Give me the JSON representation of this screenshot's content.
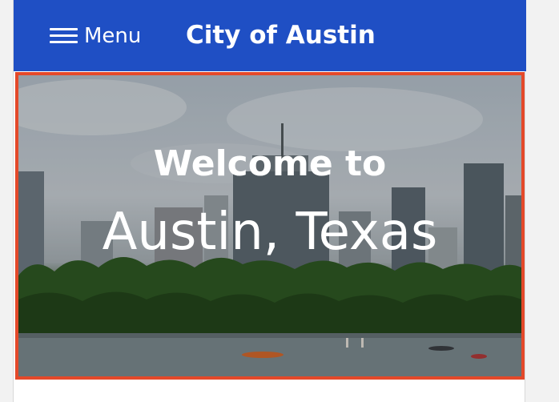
{
  "header": {
    "menu_label": "Menu",
    "site_title": "City of Austin",
    "background_color": "#1f4fc4"
  },
  "hero": {
    "welcome_text": "Welcome to",
    "city_text": "Austin, Texas",
    "focus_outline_color": "#e4492a"
  },
  "icons": {
    "menu": "hamburger-icon"
  }
}
